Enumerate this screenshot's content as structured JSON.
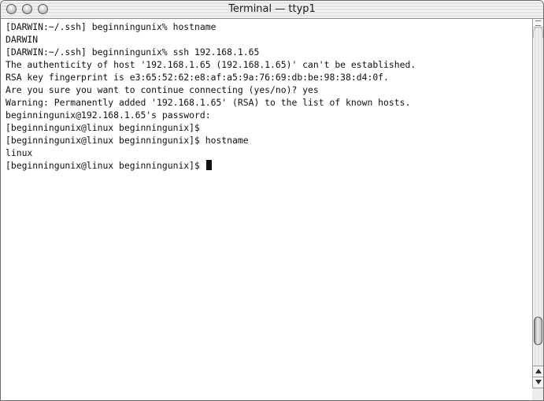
{
  "window": {
    "title": "Terminal — ttyp1"
  },
  "terminal": {
    "lines": [
      "[DARWIN:~/.ssh] beginningunix% hostname",
      "DARWIN",
      "[DARWIN:~/.ssh] beginningunix% ssh 192.168.1.65",
      "The authenticity of host '192.168.1.65 (192.168.1.65)' can't be established.",
      "RSA key fingerprint is e3:65:52:62:e8:af:a5:9a:76:69:db:be:98:38:d4:0f.",
      "Are you sure you want to continue connecting (yes/no)? yes",
      "Warning: Permanently added '192.168.1.65' (RSA) to the list of known hosts.",
      "beginningunix@192.168.1.65's password:",
      "[beginningunix@linux beginningunix]$",
      "[beginningunix@linux beginningunix]$ hostname",
      "linux",
      "[beginningunix@linux beginningunix]$ "
    ]
  },
  "colors": {
    "text": "#111111",
    "background": "#ffffff"
  },
  "icons": {
    "close": "close-icon",
    "minimize": "minimize-icon",
    "zoom": "zoom-icon"
  }
}
